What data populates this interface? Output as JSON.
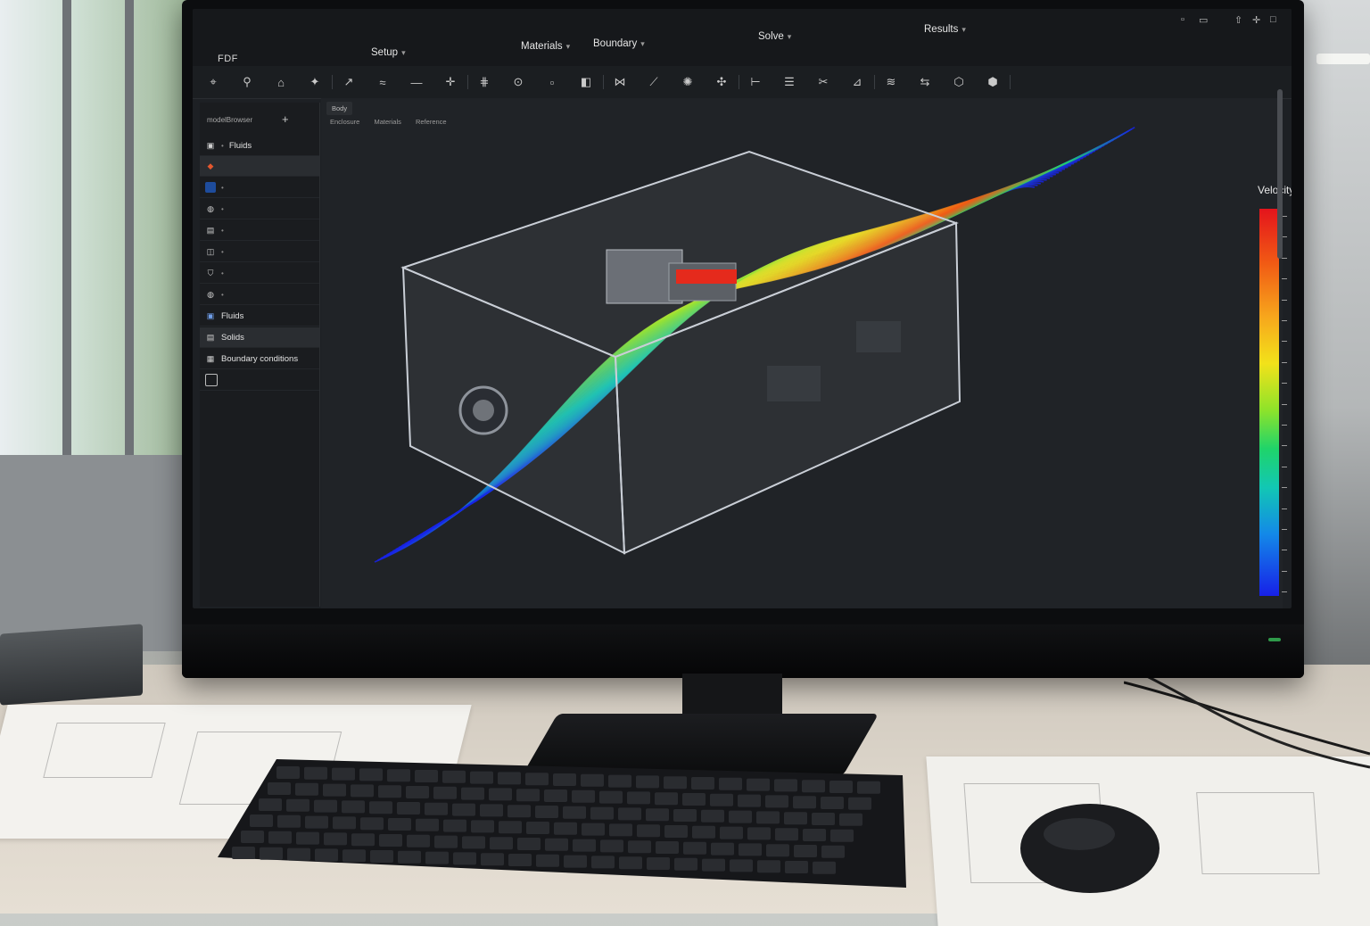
{
  "app": {
    "title": "FDF"
  },
  "menu": [
    {
      "label": "Setup"
    },
    {
      "label": "Materials"
    },
    {
      "label": "Boundary"
    },
    {
      "label": "Solve"
    },
    {
      "label": "Results"
    }
  ],
  "toolbar": {
    "icons": [
      "select-icon",
      "probe-icon",
      "pin-icon",
      "mesh-icon",
      "vector-icon",
      "flow-icon",
      "line-icon",
      "axis-icon",
      "grid-icon",
      "sensor-icon",
      "cell-icon",
      "box-icon",
      "split-icon",
      "arrow-icon",
      "fan-icon",
      "move-icon",
      "measure-icon",
      "stack-icon",
      "cut-icon",
      "plot-icon",
      "stream-icon",
      "mirror-icon",
      "iso-icon",
      "render-icon"
    ]
  },
  "sidebar": {
    "header": "modelBrowser",
    "items": [
      {
        "label": "Fluids",
        "icon": "fluid-icon",
        "big": true
      },
      {
        "label": "Fluids",
        "icon": "fluid-icon",
        "big": true
      },
      {
        "label": "Solids",
        "icon": "solid-icon",
        "big": true
      },
      {
        "label": "Boundary conditions",
        "icon": "boundary-icon",
        "big": true
      }
    ]
  },
  "viewport": {
    "tab_label": "Body",
    "breadcrumb": [
      "Enclosure",
      "Materials",
      "Reference"
    ]
  },
  "legend": {
    "title": "Velocity",
    "colors": [
      "#e4141c",
      "#f15a14",
      "#f7a71c",
      "#f2e21a",
      "#8ee32a",
      "#1fd46a",
      "#12c7b4",
      "#1389e8",
      "#1720e8"
    ]
  }
}
